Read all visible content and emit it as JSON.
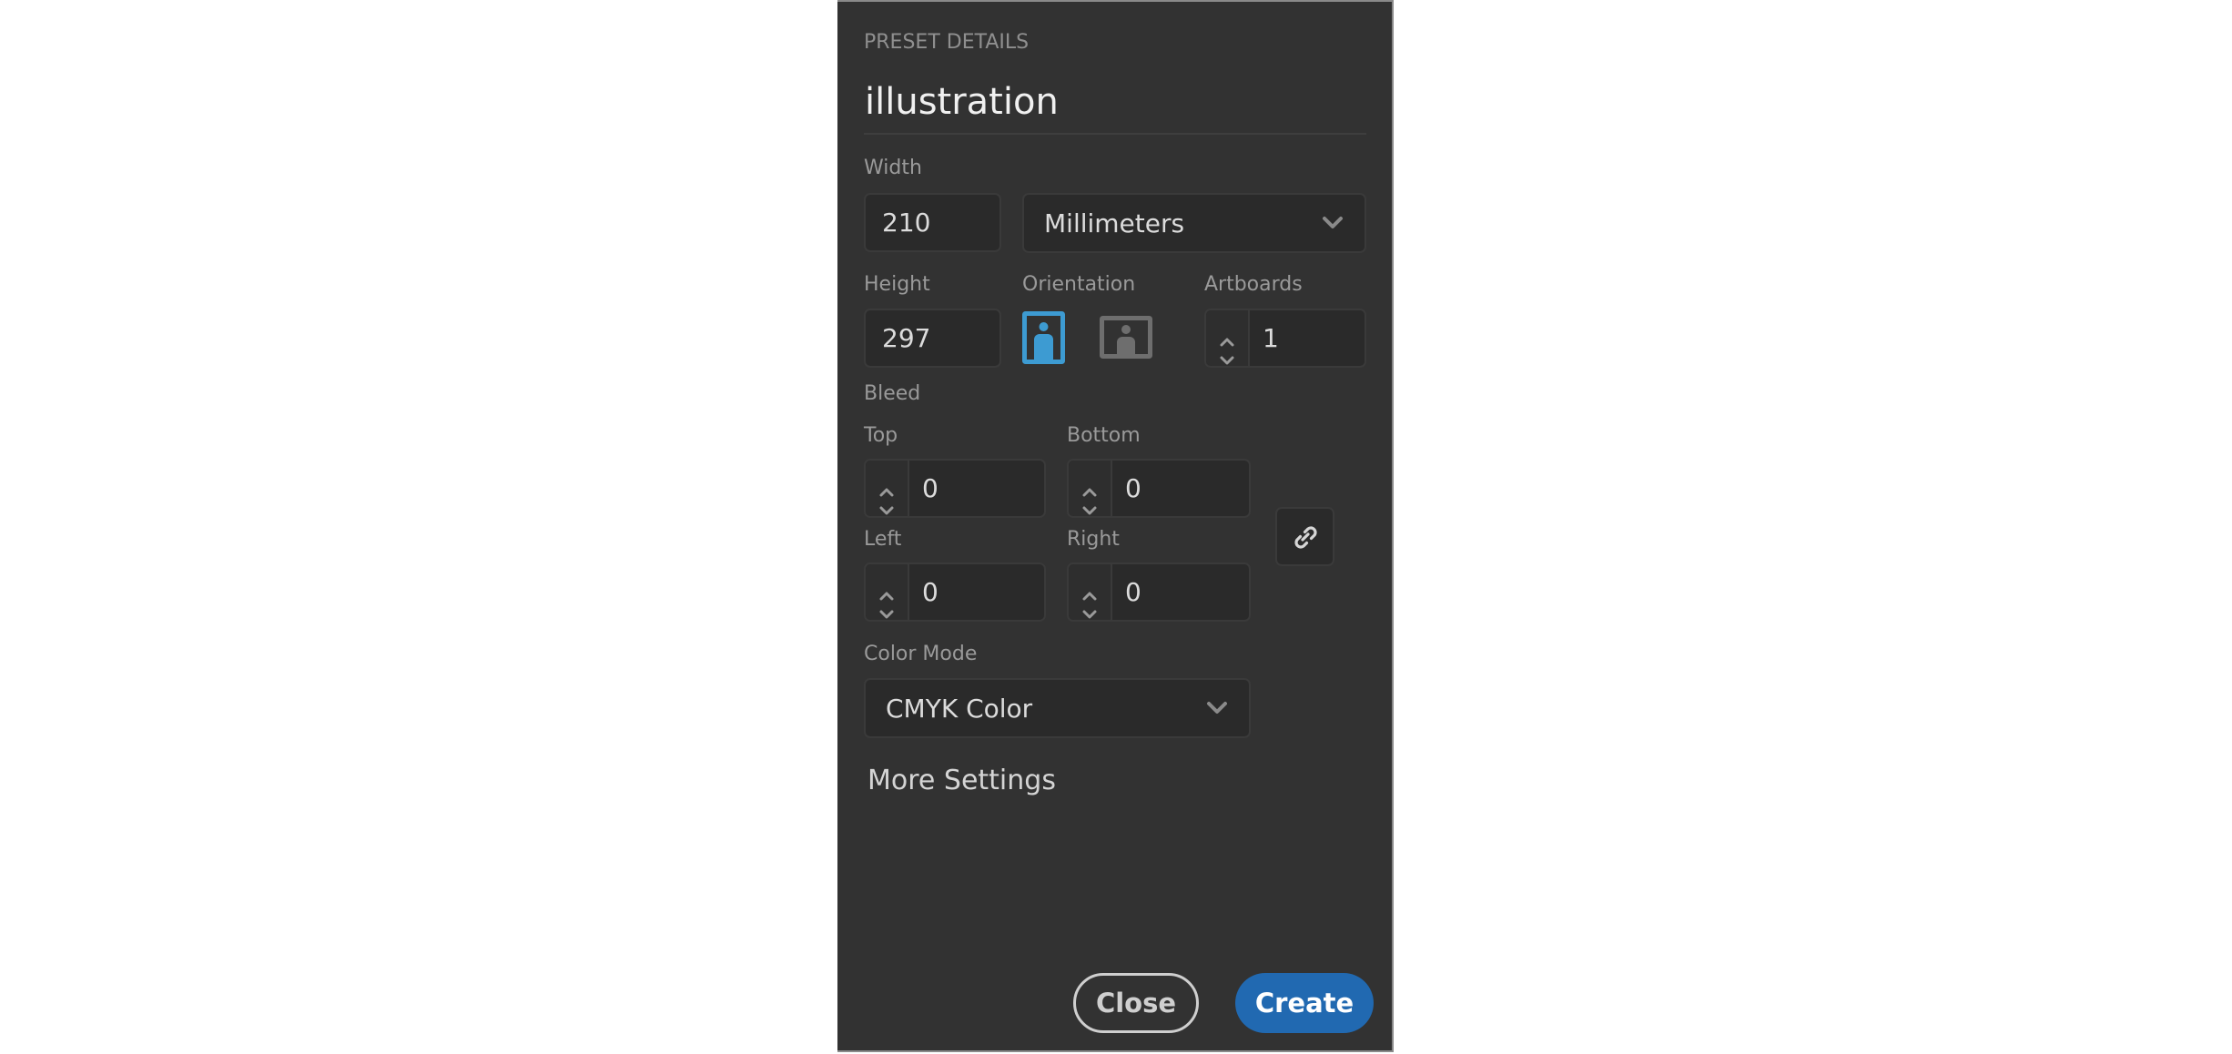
{
  "dialog": {
    "section_title": "PRESET DETAILS",
    "preset_name": "illustration"
  },
  "width": {
    "label": "Width",
    "value": "210"
  },
  "units": {
    "selected": "Millimeters"
  },
  "height": {
    "label": "Height",
    "value": "297"
  },
  "orientation": {
    "label": "Orientation",
    "selected": "portrait",
    "options": [
      "portrait",
      "landscape"
    ],
    "active_color": "#3d9bd2",
    "inactive_color": "#6e6e6e"
  },
  "artboards": {
    "label": "Artboards",
    "value": "1"
  },
  "bleed": {
    "label": "Bleed",
    "top": {
      "label": "Top",
      "value": "0"
    },
    "bottom": {
      "label": "Bottom",
      "value": "0"
    },
    "left": {
      "label": "Left",
      "value": "0"
    },
    "right": {
      "label": "Right",
      "value": "0"
    },
    "linked": true
  },
  "color_mode": {
    "label": "Color Mode",
    "selected": "CMYK Color"
  },
  "more_settings": {
    "label": "More Settings"
  },
  "buttons": {
    "close": "Close",
    "create": "Create",
    "create_color": "#2169b1"
  }
}
